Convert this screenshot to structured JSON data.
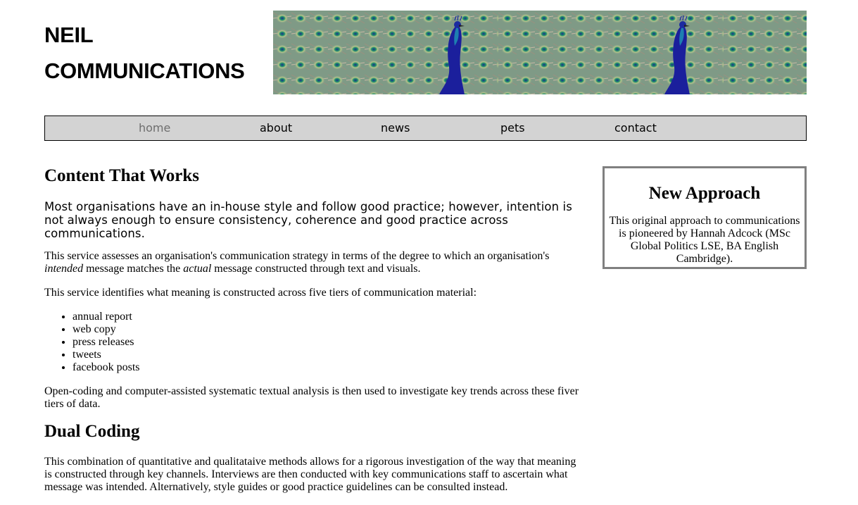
{
  "header": {
    "logo_line1": "NEIL",
    "logo_line2": "COMMUNICATIONS"
  },
  "nav": {
    "items": [
      "home",
      "about",
      "news",
      "pets",
      "contact"
    ],
    "active": "home"
  },
  "main": {
    "heading1": "Content That Works",
    "lead": "Most organisations have an in-house style and follow good practice; however, intention is not always enough to ensure consistency, coherence and good practice across communications.",
    "p1_a": "This service assesses an organisation's communication strategy in terms of the degree to which an organisation's ",
    "p1_em1": "intended",
    "p1_b": " message matches the ",
    "p1_em2": "actual",
    "p1_c": " message constructed through text and visuals.",
    "p2": "This service identifies what meaning is constructed across five tiers of communication material:",
    "list": [
      "annual report",
      "web copy",
      "press releases",
      "tweets",
      "facebook posts"
    ],
    "p3": "Open-coding and computer-assisted systematic textual analysis is then used to investigate key trends across these fiver tiers of data.",
    "heading2": "Dual Coding",
    "p4": "This combination of quantitative and qualitataive methods allows for a rigorous investigation of the way that meaning is constructed through key channels. Interviews are then conducted with key communications staff to ascertain what message was intended. Alternatively, style guides or good practice guidelines can be consulted instead."
  },
  "sidebar": {
    "title": "New Approach",
    "text": "This original approach to communications is pioneered by Hannah Adcock (MSc Global Politics LSE, BA English Cambridge)."
  },
  "colors": {
    "nav_bg": "#d3d3d3",
    "active_link": "#6e6e6e",
    "sidebar_border": "#808080"
  }
}
